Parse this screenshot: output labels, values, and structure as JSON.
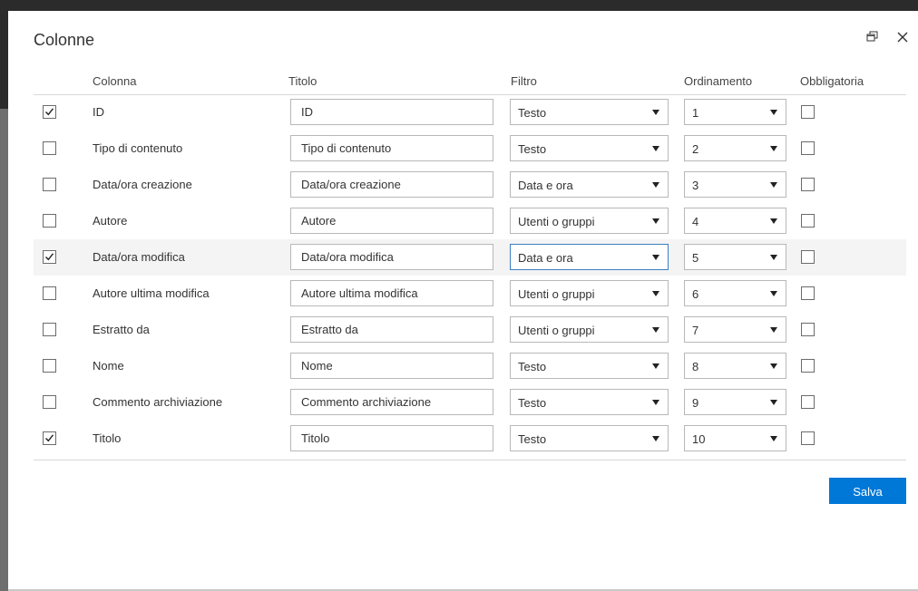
{
  "dialog": {
    "title": "Colonne",
    "restore_icon": "restore-window-icon",
    "close_icon": "close-icon"
  },
  "headers": {
    "column": "Colonna",
    "title": "Titolo",
    "filter": "Filtro",
    "sort": "Ordinamento",
    "required": "Obbligatoria"
  },
  "rows": [
    {
      "selected": true,
      "column": "ID",
      "title": "ID",
      "filter": "Testo",
      "sort": "1",
      "required": false
    },
    {
      "selected": false,
      "column": "Tipo di contenuto",
      "title": "Tipo di contenuto",
      "filter": "Testo",
      "sort": "2",
      "required": false
    },
    {
      "selected": false,
      "column": "Data/ora creazione",
      "title": "Data/ora creazione",
      "filter": "Data e ora",
      "sort": "3",
      "required": false
    },
    {
      "selected": false,
      "column": "Autore",
      "title": "Autore",
      "filter": "Utenti o gruppi",
      "sort": "4",
      "required": false
    },
    {
      "selected": true,
      "column": "Data/ora modifica",
      "title": "Data/ora modifica",
      "filter": "Data e ora",
      "sort": "5",
      "required": false
    },
    {
      "selected": false,
      "column": "Autore ultima modifica",
      "title": "Autore ultima modifica",
      "filter": "Utenti o gruppi",
      "sort": "6",
      "required": false
    },
    {
      "selected": false,
      "column": "Estratto da",
      "title": "Estratto da",
      "filter": "Utenti o gruppi",
      "sort": "7",
      "required": false
    },
    {
      "selected": false,
      "column": "Nome",
      "title": "Nome",
      "filter": "Testo",
      "sort": "8",
      "required": false
    },
    {
      "selected": false,
      "column": "Commento archiviazione",
      "title": "Commento archiviazione",
      "filter": "Testo",
      "sort": "9",
      "required": false
    },
    {
      "selected": true,
      "column": "Titolo",
      "title": "Titolo",
      "filter": "Testo",
      "sort": "10",
      "required": false
    }
  ],
  "highlighted_row": 4,
  "footer": {
    "save_label": "Salva"
  },
  "colors": {
    "accent": "#0078d7",
    "focus_border": "#3a7fc4",
    "row_highlight": "#f4f4f4"
  }
}
